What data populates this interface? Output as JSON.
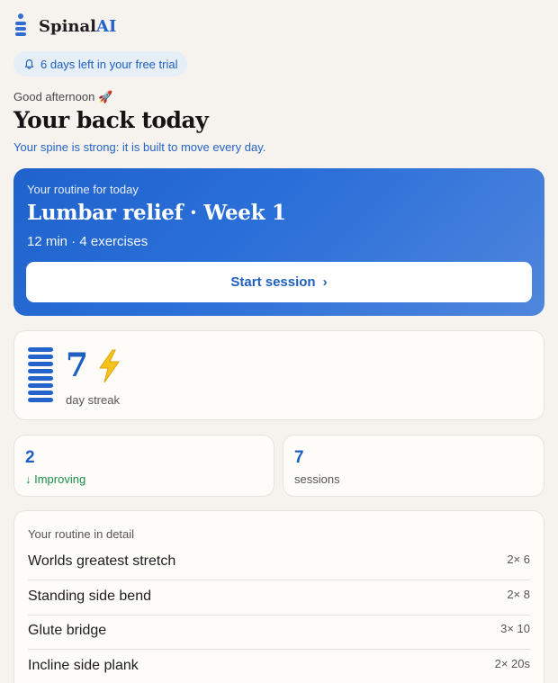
{
  "brand": {
    "name_prefix": "Spinal",
    "name_suffix": "AI"
  },
  "trial": {
    "text": "6 days left in your free trial"
  },
  "greeting": {
    "hello": "Good afternoon 🚀",
    "title": "Your back today",
    "subtitle": "Your spine is strong: it is built to move every day."
  },
  "routine_card": {
    "label": "Your routine for today",
    "title": "Lumbar relief · Week 1",
    "meta": "12 min · 4 exercises",
    "button": "Start session",
    "button_chevron": "›"
  },
  "streak": {
    "value": "7",
    "label": "day streak"
  },
  "stats": [
    {
      "value": "2",
      "label": "↓ Improving"
    },
    {
      "value": "7",
      "label": "sessions"
    }
  ],
  "routine_detail": {
    "heading": "Your routine in detail",
    "exercises": [
      {
        "name": "Worlds greatest stretch",
        "reps": "2× 6"
      },
      {
        "name": "Standing side bend",
        "reps": "2× 8"
      },
      {
        "name": "Glute bridge",
        "reps": "3× 10"
      },
      {
        "name": "Incline side plank",
        "reps": "2× 20s"
      }
    ]
  },
  "colors": {
    "accent": "#2463c9",
    "positive": "#1a8f4a",
    "background": "#f6f3ee"
  },
  "icons": {
    "logo": "spine-logo-icon",
    "trial": "bell-icon",
    "streak": "spine-icon",
    "streak_extra": "lightning-bolt-icon"
  }
}
